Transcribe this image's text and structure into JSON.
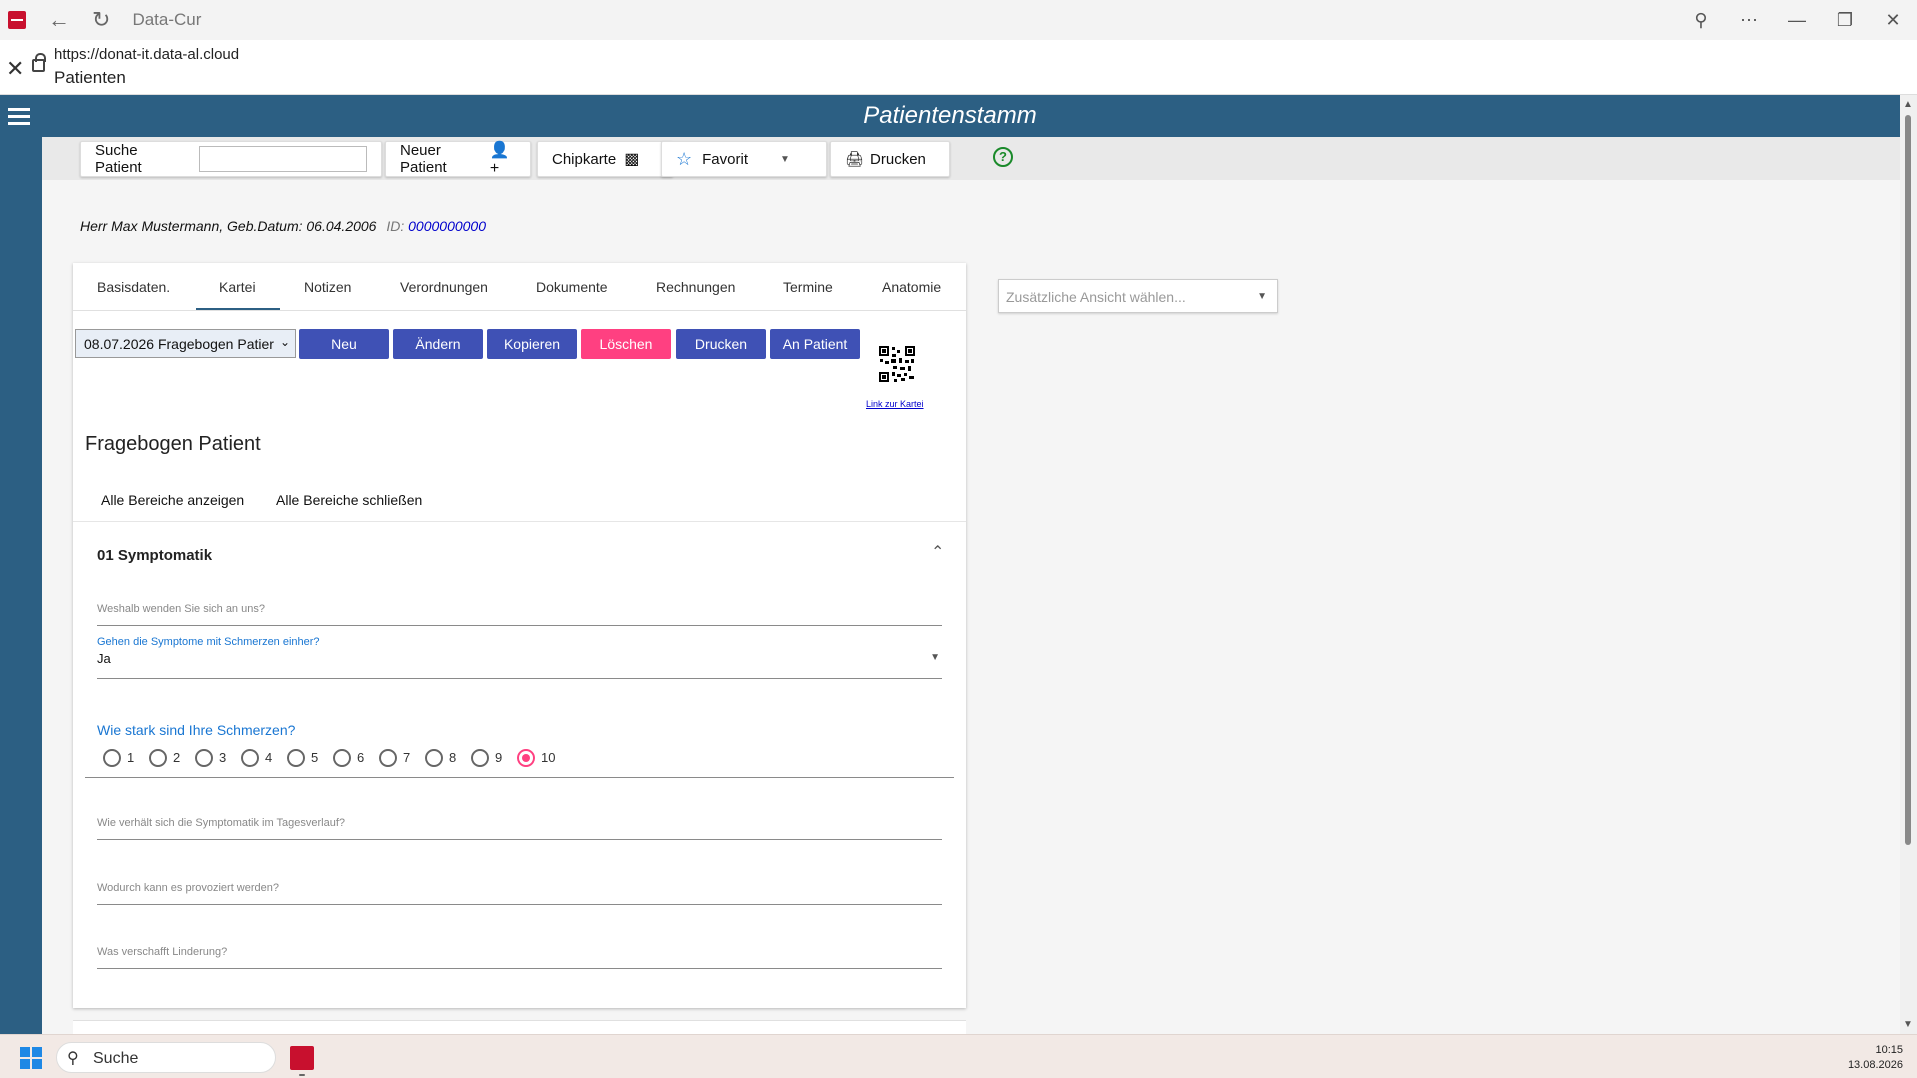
{
  "browser": {
    "window_title": "Data-Cur",
    "url": "https://donat-it.data-al.cloud",
    "page_title": "Patienten"
  },
  "app": {
    "title": "Patientenstamm",
    "accent_color": "#2c5f83"
  },
  "toolbar": {
    "search_label": "Suche Patient",
    "search_value": "",
    "new_patient": "Neuer Patient",
    "chipcard": "Chipkarte",
    "favorite": "Favorit",
    "print": "Drucken",
    "help": "?"
  },
  "patient": {
    "summary": "Herr Max Mustermann, Geb.Datum: 06.04.2006",
    "id_label": "ID:",
    "id_value": "0000000000"
  },
  "tabs": [
    {
      "label": "Basisdaten."
    },
    {
      "label": "Kartei",
      "active": true
    },
    {
      "label": "Notizen"
    },
    {
      "label": "Verordnungen"
    },
    {
      "label": "Dokumente"
    },
    {
      "label": "Rechnungen"
    },
    {
      "label": "Termine"
    },
    {
      "label": "Anatomie"
    }
  ],
  "record": {
    "selected": "08.07.2026 Fragebogen Patier",
    "buttons": {
      "new": "Neu",
      "edit": "Ändern",
      "copy": "Kopieren",
      "delete": "Löschen",
      "print": "Drucken",
      "to_patient": "An Patient"
    },
    "qr_link": "Link zur Kartei"
  },
  "form": {
    "title": "Fragebogen Patient",
    "show_all": "Alle Bereiche anzeigen",
    "close_all": "Alle Bereiche schließen",
    "section_title": "01 Symptomatik",
    "q_reason_placeholder": "Weshalb wenden Sie sich an uns?",
    "q_pain_label": "Gehen die Symptome mit Schmerzen einher?",
    "q_pain_value": "Ja",
    "q_intensity_label": "Wie stark sind Ihre Schmerzen?",
    "intensity_options": [
      "1",
      "2",
      "3",
      "4",
      "5",
      "6",
      "7",
      "8",
      "9",
      "10"
    ],
    "intensity_selected": "10",
    "q_daily_placeholder": "Wie verhält sich die Symptomatik im Tagesverlauf?",
    "q_provoke_placeholder": "Wodurch kann es provoziert werden?",
    "q_relief_placeholder": "Was verschafft Linderung?"
  },
  "side_panel": {
    "select_placeholder": "Zusätzliche Ansicht wählen..."
  },
  "taskbar": {
    "search": "Suche",
    "time": "10:15",
    "date": "13.08.2026"
  }
}
